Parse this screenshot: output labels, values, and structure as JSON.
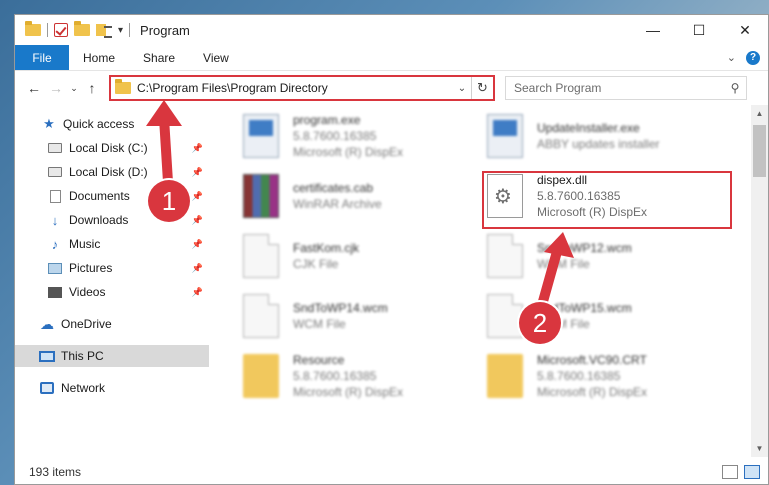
{
  "window": {
    "title": "Program",
    "controls": {
      "minimize": "—",
      "maximize": "☐",
      "close": "✕"
    }
  },
  "ribbon": {
    "file": "File",
    "tabs": [
      "Home",
      "Share",
      "View"
    ]
  },
  "navbar": {
    "back": "←",
    "forward": "→",
    "recent": "⌄",
    "up": "↑",
    "address": "C:\\Program Files\\Program Directory",
    "search_placeholder": "Search Program"
  },
  "sidebar": {
    "items": [
      {
        "label": "Quick access",
        "icon": "star-icon",
        "pinned": false
      },
      {
        "label": "Local Disk (C:)",
        "icon": "drive-icon",
        "pinned": true
      },
      {
        "label": "Local Disk (D:)",
        "icon": "drive-icon",
        "pinned": true
      },
      {
        "label": "Documents",
        "icon": "document-icon",
        "pinned": true
      },
      {
        "label": "Downloads",
        "icon": "download-icon",
        "pinned": true
      },
      {
        "label": "Music",
        "icon": "music-icon",
        "pinned": true
      },
      {
        "label": "Pictures",
        "icon": "pictures-icon",
        "pinned": true
      },
      {
        "label": "Videos",
        "icon": "video-icon",
        "pinned": true
      },
      {
        "label": "OneDrive",
        "icon": "cloud-icon",
        "pinned": false
      },
      {
        "label": "This PC",
        "icon": "monitor-icon",
        "pinned": false,
        "selected": true
      },
      {
        "label": "Network",
        "icon": "network-icon",
        "pinned": false
      }
    ]
  },
  "files": [
    {
      "name": "program.exe",
      "line2": "5.8.7600.16385",
      "line3": "Microsoft (R) DispEx",
      "icon": "exe-icon"
    },
    {
      "name": "UpdateInstaller.exe",
      "line2": "ABBY updates installer",
      "line3": "",
      "icon": "exe-icon"
    },
    {
      "name": "certificates.cab",
      "line2": "WinRAR Archive",
      "line3": "",
      "icon": "archive-icon"
    },
    {
      "name": "dispex.dll",
      "line2": "5.8.7600.16385",
      "line3": "Microsoft (R) DispEx",
      "icon": "dll-gear-icon"
    },
    {
      "name": "FastKom.cjk",
      "line2": "CJK File",
      "line3": "",
      "icon": "file-icon"
    },
    {
      "name": "SndToWP12.wcm",
      "line2": "WCM File",
      "line3": "",
      "icon": "file-icon"
    },
    {
      "name": "SndToWP14.wcm",
      "line2": "WCM File",
      "line3": "",
      "icon": "file-icon"
    },
    {
      "name": "SndToWP15.wcm",
      "line2": "WCM File",
      "line3": "",
      "icon": "file-icon"
    },
    {
      "name": "Resource",
      "line2": "5.8.7600.16385",
      "line3": "Microsoft (R) DispEx",
      "icon": "folder-icon"
    },
    {
      "name": "Microsoft.VC90.CRT",
      "line2": "5.8.7600.16385",
      "line3": "Microsoft (R) DispEx",
      "icon": "folder-icon"
    }
  ],
  "status": {
    "item_count": "193 items"
  },
  "annotations": {
    "step1": "1",
    "step2": "2",
    "color": "#d9363e"
  }
}
